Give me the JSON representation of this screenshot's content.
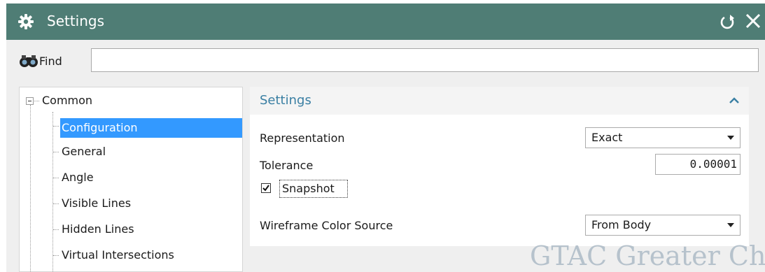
{
  "window": {
    "title": "Settings",
    "title_icon": "gear-icon",
    "actions": [
      {
        "name": "reset-icon",
        "label": "Reset"
      },
      {
        "name": "close-icon",
        "label": "Close"
      }
    ]
  },
  "find": {
    "icon": "binoculars-icon",
    "label": "Find",
    "value": "",
    "placeholder": ""
  },
  "tree": {
    "group": "Common",
    "expanded": true,
    "items": [
      {
        "label": "Configuration",
        "selected": true
      },
      {
        "label": "General",
        "selected": false
      },
      {
        "label": "Angle",
        "selected": false
      },
      {
        "label": "Visible Lines",
        "selected": false
      },
      {
        "label": "Hidden Lines",
        "selected": false
      },
      {
        "label": "Virtual Intersections",
        "selected": false
      }
    ]
  },
  "panel": {
    "title": "Settings",
    "collapse_icon": "chevron-up-icon",
    "representation": {
      "label": "Representation",
      "value": "Exact"
    },
    "tolerance": {
      "label": "Tolerance",
      "value": "0.00001"
    },
    "snapshot": {
      "label": "Snapshot",
      "checked": true
    },
    "wireframe_color_source": {
      "label": "Wireframe Color Source",
      "value": "From Body"
    }
  },
  "watermark": "GTAC Greater Chi",
  "colors": {
    "titlebar": "#4f7d75",
    "selection": "#3399ff",
    "panel_title": "#3a7fa3",
    "background": "#efefef"
  }
}
